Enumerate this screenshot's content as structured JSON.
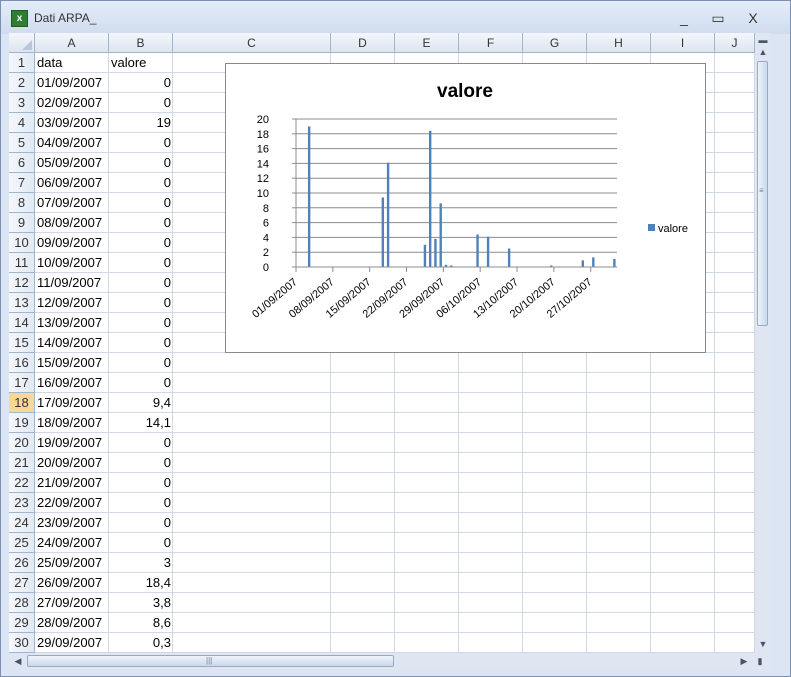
{
  "window": {
    "title": "Dati ARPA_",
    "minimize_label": "_",
    "maximize_label": "▭",
    "close_label": "X"
  },
  "columns": [
    "A",
    "B",
    "C",
    "D",
    "E",
    "F",
    "G",
    "H",
    "I",
    "J"
  ],
  "rows": [
    {
      "n": "1",
      "a": "data",
      "b": "valore"
    },
    {
      "n": "2",
      "a": "01/09/2007",
      "b": "0"
    },
    {
      "n": "3",
      "a": "02/09/2007",
      "b": "0"
    },
    {
      "n": "4",
      "a": "03/09/2007",
      "b": "19"
    },
    {
      "n": "5",
      "a": "04/09/2007",
      "b": "0"
    },
    {
      "n": "6",
      "a": "05/09/2007",
      "b": "0"
    },
    {
      "n": "7",
      "a": "06/09/2007",
      "b": "0"
    },
    {
      "n": "8",
      "a": "07/09/2007",
      "b": "0"
    },
    {
      "n": "9",
      "a": "08/09/2007",
      "b": "0"
    },
    {
      "n": "10",
      "a": "09/09/2007",
      "b": "0"
    },
    {
      "n": "11",
      "a": "10/09/2007",
      "b": "0"
    },
    {
      "n": "12",
      "a": "11/09/2007",
      "b": "0"
    },
    {
      "n": "13",
      "a": "12/09/2007",
      "b": "0"
    },
    {
      "n": "14",
      "a": "13/09/2007",
      "b": "0"
    },
    {
      "n": "15",
      "a": "14/09/2007",
      "b": "0"
    },
    {
      "n": "16",
      "a": "15/09/2007",
      "b": "0"
    },
    {
      "n": "17",
      "a": "16/09/2007",
      "b": "0"
    },
    {
      "n": "18",
      "a": "17/09/2007",
      "b": "9,4"
    },
    {
      "n": "19",
      "a": "18/09/2007",
      "b": "14,1"
    },
    {
      "n": "20",
      "a": "19/09/2007",
      "b": "0"
    },
    {
      "n": "21",
      "a": "20/09/2007",
      "b": "0"
    },
    {
      "n": "22",
      "a": "21/09/2007",
      "b": "0"
    },
    {
      "n": "23",
      "a": "22/09/2007",
      "b": "0"
    },
    {
      "n": "24",
      "a": "23/09/2007",
      "b": "0"
    },
    {
      "n": "25",
      "a": "24/09/2007",
      "b": "0"
    },
    {
      "n": "26",
      "a": "25/09/2007",
      "b": "3"
    },
    {
      "n": "27",
      "a": "26/09/2007",
      "b": "18,4"
    },
    {
      "n": "28",
      "a": "27/09/2007",
      "b": "3,8"
    },
    {
      "n": "29",
      "a": "28/09/2007",
      "b": "8,6"
    },
    {
      "n": "30",
      "a": "29/09/2007",
      "b": "0,3"
    }
  ],
  "selected_row": "18",
  "colors": {
    "bar": "#4f81bd",
    "selected_header": "#f8d797",
    "grid": "#d0d7e5"
  },
  "chart_data": {
    "type": "bar",
    "title": "valore",
    "legend": [
      "valore"
    ],
    "legend_position": "right",
    "ylim": [
      0,
      20
    ],
    "y_ticks": [
      0,
      2,
      4,
      6,
      8,
      10,
      12,
      14,
      16,
      18,
      20
    ],
    "grid": true,
    "x_start": "01/09/2007",
    "x_end": "31/10/2007",
    "x_tick_labels": [
      "01/09/2007",
      "08/09/2007",
      "15/09/2007",
      "22/09/2007",
      "29/09/2007",
      "06/10/2007",
      "13/10/2007",
      "20/10/2007",
      "27/10/2007"
    ],
    "points": [
      {
        "x": "03/09/2007",
        "y": 19
      },
      {
        "x": "17/09/2007",
        "y": 9.4
      },
      {
        "x": "18/09/2007",
        "y": 14.1
      },
      {
        "x": "25/09/2007",
        "y": 3
      },
      {
        "x": "26/09/2007",
        "y": 18.4
      },
      {
        "x": "27/09/2007",
        "y": 3.8
      },
      {
        "x": "28/09/2007",
        "y": 8.6
      },
      {
        "x": "29/09/2007",
        "y": 0.3
      },
      {
        "x": "30/09/2007",
        "y": 0.2
      },
      {
        "x": "05/10/2007",
        "y": 4.4
      },
      {
        "x": "07/10/2007",
        "y": 4.1
      },
      {
        "x": "11/10/2007",
        "y": 2.5
      },
      {
        "x": "19/10/2007",
        "y": 0.2
      },
      {
        "x": "25/10/2007",
        "y": 0.9
      },
      {
        "x": "27/10/2007",
        "y": 1.3
      },
      {
        "x": "31/10/2007",
        "y": 1.1
      }
    ]
  }
}
